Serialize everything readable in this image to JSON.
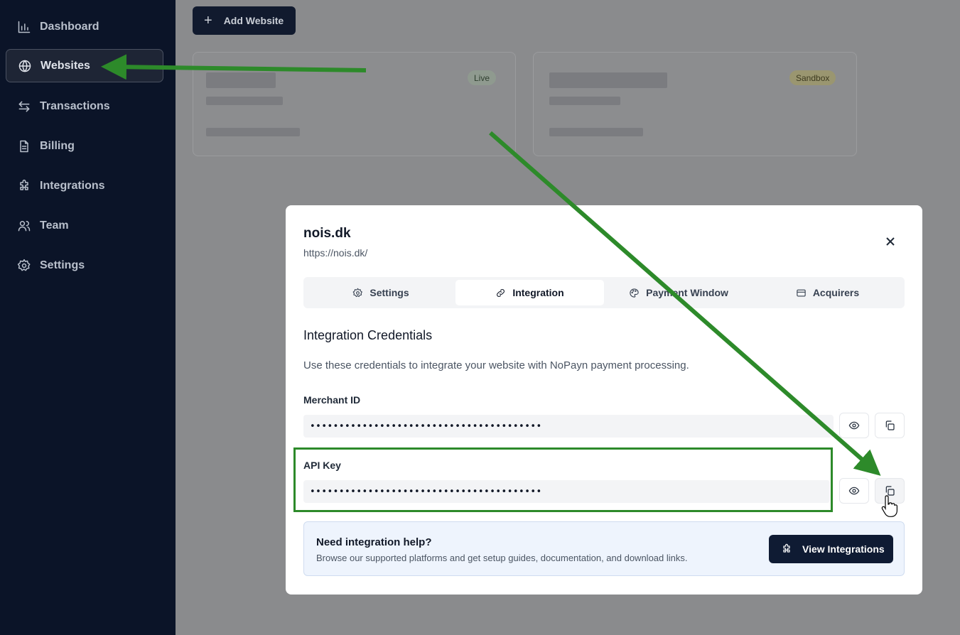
{
  "sidebar": {
    "items": [
      {
        "label": "Dashboard",
        "icon": "bar-chart-icon"
      },
      {
        "label": "Websites",
        "icon": "globe-icon",
        "active": true
      },
      {
        "label": "Transactions",
        "icon": "arrows-icon"
      },
      {
        "label": "Billing",
        "icon": "document-icon"
      },
      {
        "label": "Integrations",
        "icon": "puzzle-icon"
      },
      {
        "label": "Team",
        "icon": "users-icon"
      },
      {
        "label": "Settings",
        "icon": "gear-icon"
      }
    ]
  },
  "main": {
    "add_website_label": "Add Website",
    "cards": [
      {
        "badge": "Live",
        "badge_color": "#c8dcc8"
      },
      {
        "badge": "Sandbox",
        "badge_color": "#e8e1a0"
      }
    ]
  },
  "modal": {
    "title": "nois.dk",
    "url": "https://nois.dk/",
    "tabs": [
      {
        "label": "Settings",
        "icon": "gear-icon"
      },
      {
        "label": "Integration",
        "icon": "link-icon",
        "active": true
      },
      {
        "label": "Payment Window",
        "icon": "palette-icon"
      },
      {
        "label": "Acquirers",
        "icon": "card-icon"
      }
    ],
    "section_title": "Integration Credentials",
    "section_desc": "Use these credentials to integrate your website with NoPayn payment processing.",
    "merchant_id": {
      "label": "Merchant ID",
      "value": "••••••••••••••••••••••••••••••••••••••••"
    },
    "api_key": {
      "label": "API Key",
      "value": "••••••••••••••••••••••••••••••••••••••••"
    },
    "help": {
      "title": "Need integration help?",
      "desc": "Browse our supported platforms and get setup guides, documentation, and download links.",
      "button_label": "View Integrations"
    }
  },
  "colors": {
    "sidebar_bg": "#0b1428",
    "annotation_green": "#2d8a2a",
    "primary_button": "#0f1b33"
  }
}
